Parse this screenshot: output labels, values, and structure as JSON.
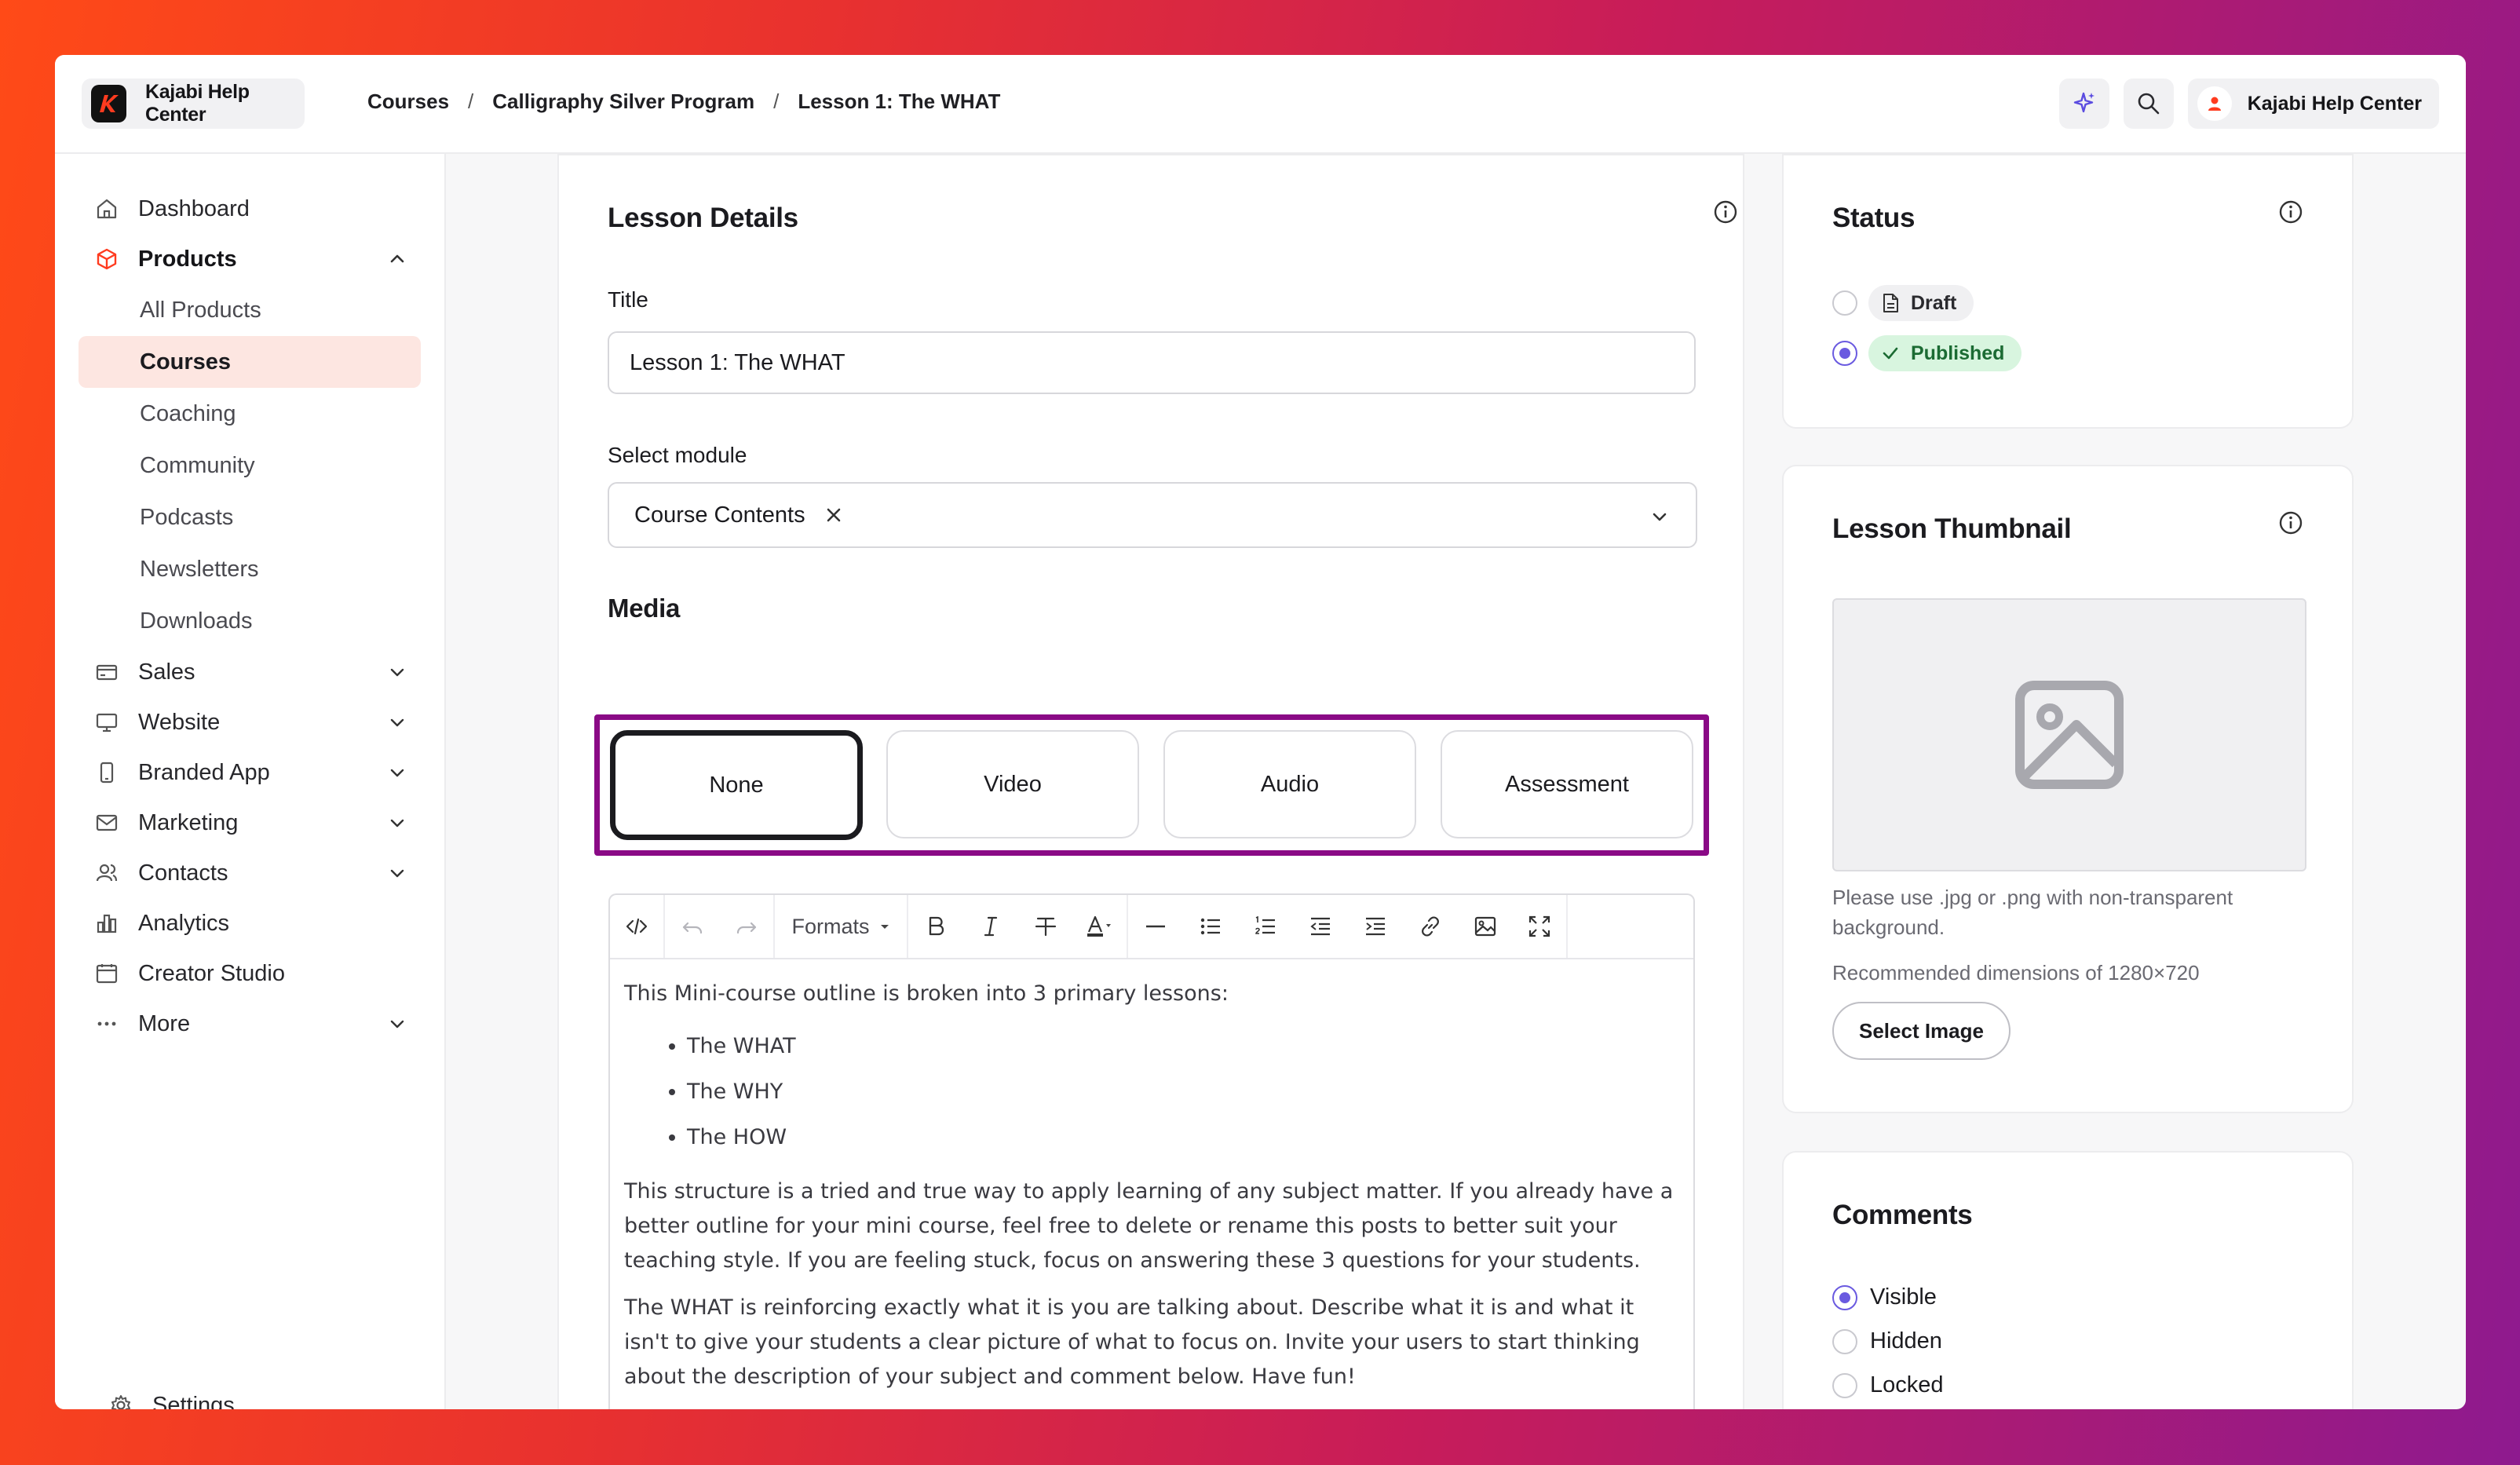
{
  "app": {
    "name": "Kajabi Help Center",
    "user_name": "Kajabi Help Center"
  },
  "breadcrumb": [
    "Courses",
    "Calligraphy Silver Program",
    "Lesson 1: The WHAT"
  ],
  "sidebar": {
    "items": [
      {
        "label": "Dashboard",
        "icon": "home-icon"
      },
      {
        "label": "Products",
        "icon": "box-icon",
        "expanded": true
      },
      {
        "label": "Sales",
        "icon": "credit-card-icon"
      },
      {
        "label": "Website",
        "icon": "monitor-icon"
      },
      {
        "label": "Branded App",
        "icon": "phone-icon"
      },
      {
        "label": "Marketing",
        "icon": "mail-icon"
      },
      {
        "label": "Contacts",
        "icon": "users-icon"
      },
      {
        "label": "Analytics",
        "icon": "bar-chart-icon"
      },
      {
        "label": "Creator Studio",
        "icon": "calendar-icon"
      },
      {
        "label": "More",
        "icon": "dots-icon"
      }
    ],
    "product_subitems": [
      "All Products",
      "Courses",
      "Coaching",
      "Community",
      "Podcasts",
      "Newsletters",
      "Downloads"
    ],
    "selected_subitem": "Courses",
    "settings_label": "Settings"
  },
  "lesson_details": {
    "heading": "Lesson Details",
    "title_label": "Title",
    "title_value": "Lesson 1: The WHAT",
    "module_label": "Select module",
    "module_value": "Course Contents",
    "media_heading": "Media",
    "media_options": [
      "None",
      "Video",
      "Audio",
      "Assessment"
    ],
    "media_selected": "None"
  },
  "editor": {
    "formats_label": "Formats",
    "intro": "This Mini-course outline is broken into 3 primary lessons:",
    "bullets": [
      "The WHAT",
      "The WHY",
      "The HOW"
    ],
    "para1": "This structure is a tried and true way to apply learning of any subject matter. If you already have a better outline for your mini course, feel free to delete or rename this posts to better suit your teaching style. If you are feeling stuck, focus on answering these 3 questions for your students.",
    "para2": "The WHAT is reinforcing exactly what it is you are talking about. Describe what it is and what it isn't to give your students a clear picture of what to focus on. Invite your users to start thinking about the description of your subject and comment below. Have fun!"
  },
  "status": {
    "heading": "Status",
    "options": [
      "Draft",
      "Published"
    ],
    "selected": "Published"
  },
  "thumbnail": {
    "heading": "Lesson Thumbnail",
    "hint": "Please use .jpg or .png with non-transparent background.",
    "dimensions_hint": "Recommended dimensions of 1280×720",
    "button_label": "Select Image"
  },
  "comments": {
    "heading": "Comments",
    "options": [
      "Visible",
      "Hidden",
      "Locked"
    ],
    "selected": "Visible"
  },
  "colors": {
    "accent": "#6a5ae0",
    "brand": "#ff4a17",
    "highlight_frame": "#8a0a86",
    "selected_nav_bg": "#fde6e1",
    "published_bg": "#d8f5df"
  }
}
